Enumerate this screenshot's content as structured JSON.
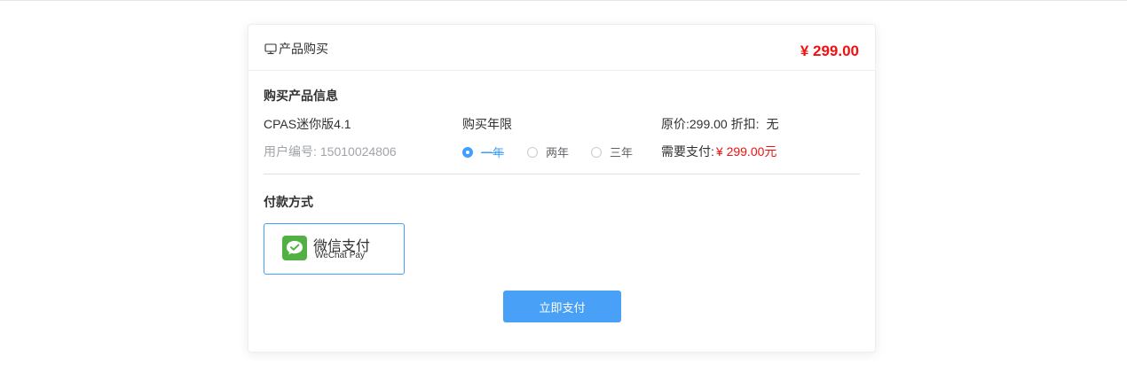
{
  "header": {
    "title": "产品购买",
    "icon": "monitor-icon",
    "total_price": "¥ 299.00"
  },
  "product_info": {
    "section_title": "购买产品信息",
    "product_name": "CPAS迷你版4.1",
    "user_id_label": "用户编号:",
    "user_id": "15010024806",
    "duration_label": "购买年限",
    "duration_options": [
      {
        "label": "一年",
        "selected": true
      },
      {
        "label": "两年",
        "selected": false
      },
      {
        "label": "三年",
        "selected": false
      }
    ],
    "original_price_label": "原价:299.00 折扣:",
    "discount_value": "无",
    "amount_due_label": "需要支付:",
    "amount_due": "¥ 299.00元"
  },
  "payment": {
    "section_title": "付款方式",
    "method_name": "微信支付",
    "method_sub": "WeChat Pay",
    "method_icon": "wechat-pay-icon",
    "submit_label": "立即支付"
  },
  "colors": {
    "accent": "#409eff",
    "price_red": "#f20f0f",
    "wechat_green": "#52b044",
    "button_blue": "#49a0f7"
  }
}
